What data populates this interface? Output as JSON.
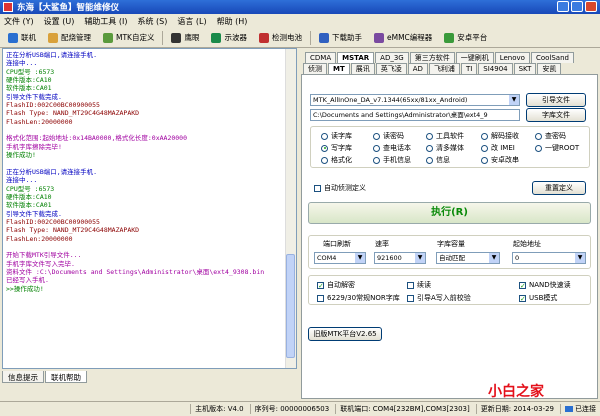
{
  "title": "东海【大鲨鱼】智能维修仪",
  "menu": [
    "文件 (Y)",
    "设置 (U)",
    "辅助工具 (I)",
    "系统 (S)",
    "语言 (L)",
    "帮助 (H)"
  ],
  "toolbar": [
    {
      "label": "联机",
      "icon": "link-icon",
      "color": "#2a6fd0"
    },
    {
      "label": "配烧管理",
      "icon": "manage-icon",
      "color": "#d9a13b"
    },
    {
      "label": "MTK自定义",
      "icon": "mtk-icon",
      "color": "#5a9a3c"
    },
    {
      "label": "鹰眼",
      "icon": "eye-icon",
      "color": "#333333"
    },
    {
      "label": "示波器",
      "icon": "oscilloscope-icon",
      "color": "#1a8a4a"
    },
    {
      "label": "检测电池",
      "icon": "battery-icon",
      "color": "#c03030"
    },
    {
      "label": "下载助手",
      "icon": "download-icon",
      "color": "#3060c0"
    },
    {
      "label": "eMMC编程器",
      "icon": "chip-icon",
      "color": "#7a4aa0"
    },
    {
      "label": "安卓平台",
      "icon": "android-icon",
      "color": "#3a9a3a"
    }
  ],
  "log_lines": [
    {
      "text": "正在分析USB端口,请连接手机.",
      "color": "#0000c0"
    },
    {
      "text": "连接中...",
      "color": "#0000c0"
    },
    {
      "text": "CPU型号 :6573",
      "color": "#008000"
    },
    {
      "text": "硬件版本:CA10",
      "color": "#008000"
    },
    {
      "text": "软件版本:CA01",
      "color": "#008000"
    },
    {
      "text": "引导文件下载完成.",
      "color": "#0000c0"
    },
    {
      "text": "FlashID:002C00BC00900055",
      "color": "#8b0000"
    },
    {
      "text": "Flash Type: NAND_MT29C4G48MAZAPAKD",
      "color": "#8b0000"
    },
    {
      "text": "FlashLen:20000000",
      "color": "#8b0000"
    },
    {
      "text": "",
      "color": "#000000"
    },
    {
      "text": "格式化范围:起始地址:0x14BA0000,格式化长度:0xAA20000",
      "color": "#a000a0"
    },
    {
      "text": "手机字库擦除完毕!",
      "color": "#a000a0"
    },
    {
      "text": "操作成功!",
      "color": "#008000"
    },
    {
      "text": "",
      "color": "#000000"
    },
    {
      "text": "正在分析USB端口,请连接手机.",
      "color": "#0000c0"
    },
    {
      "text": "连接中...",
      "color": "#0000c0"
    },
    {
      "text": "CPU型号 :6573",
      "color": "#008000"
    },
    {
      "text": "硬件版本:CA10",
      "color": "#008000"
    },
    {
      "text": "软件版本:CA01",
      "color": "#008000"
    },
    {
      "text": "引导文件下载完成.",
      "color": "#0000c0"
    },
    {
      "text": "FlashID:002C00BC00900055",
      "color": "#8b0000"
    },
    {
      "text": "Flash Type: NAND_MT29C4G48MAZAPAKD",
      "color": "#8b0000"
    },
    {
      "text": "FlashLen:20000000",
      "color": "#8b0000"
    },
    {
      "text": "",
      "color": "#000000"
    },
    {
      "text": "开始下载MTK引导文件...",
      "color": "#a000a0"
    },
    {
      "text": "手机字库文件写入完毕.",
      "color": "#a000a0"
    },
    {
      "text": "资料文件 :C:\\Documents and Settings\\Administrator\\桌面\\ext4_9308.bin",
      "color": "#a000a0"
    },
    {
      "text": "已经写入手机.",
      "color": "#a000a0"
    },
    {
      "text": ">>操作成功!",
      "color": "#008000"
    }
  ],
  "bottom_tabs": [
    "信息提示",
    "联机帮助"
  ],
  "tabs_row1": [
    "CDMA",
    "MSTAR",
    "AD_3G",
    "第三方软件",
    "一键刷机",
    "Lenovo",
    "CoolSand"
  ],
  "tabs_row2": [
    "侦测",
    "MT",
    "展讯",
    "英飞凌",
    "AD",
    "飞利浦",
    "TI",
    "SI4904",
    "SKT",
    "安凯"
  ],
  "active_tab_row1": "MSTAR",
  "active_tab_row2": "MT",
  "file_combo": "MTK_AllInOne_DA_v7.1344(65xx/81xx_Android)",
  "path_field": "C:\\Documents and Settings\\Administrator\\桌面\\ext4_9",
  "btn_boot_file": "引导文件",
  "btn_font_file": "字库文件",
  "radio_options": [
    {
      "label": "读字库",
      "checked": false
    },
    {
      "label": "读密码",
      "checked": false
    },
    {
      "label": "工具软件",
      "checked": false
    },
    {
      "label": "解码接收",
      "checked": false
    },
    {
      "label": "查密码",
      "checked": false
    },
    {
      "label": "写字库",
      "checked": true
    },
    {
      "label": "查电话本",
      "checked": false
    },
    {
      "label": "清多媒体",
      "checked": false
    },
    {
      "label": "改 IMEI",
      "checked": false
    },
    {
      "label": "一键ROOT",
      "checked": false
    },
    {
      "label": "格式化",
      "checked": false
    },
    {
      "label": "手机信息",
      "checked": false
    },
    {
      "label": "信息",
      "checked": false
    },
    {
      "label": "安卓改串",
      "checked": false
    }
  ],
  "auto_detect_label": "自动侦测定义",
  "btn_reset": "重置定义",
  "exec_label": "执行(R)",
  "port_label": "端口刷新",
  "port_value": "COM4",
  "baud_label": "速率",
  "baud_value": "921600",
  "capacity_label": "字库容量",
  "capacity_value": "自动匹配",
  "start_addr_label": "起始地址",
  "start_addr_value": "0",
  "check_options": [
    {
      "label": "自动解密",
      "checked": true
    },
    {
      "label": "续读",
      "checked": false
    },
    {
      "label": "NAND快速读",
      "checked": true
    },
    {
      "label": "6229/30常规NOR字库",
      "checked": false
    },
    {
      "label": "引导A写入前校验",
      "checked": false
    },
    {
      "label": "USB模式",
      "checked": true
    }
  ],
  "btn_old_mtk": "旧版MTK平台V2.65",
  "status": {
    "host_version": "主机版本: V4.0",
    "serial": "序列号: 00000006503",
    "port": "联机端口: COM4[232BM],COM3[2303]",
    "date": "更新日期: 2014-03-29",
    "usb": "已连接"
  },
  "watermark": "小白之家"
}
